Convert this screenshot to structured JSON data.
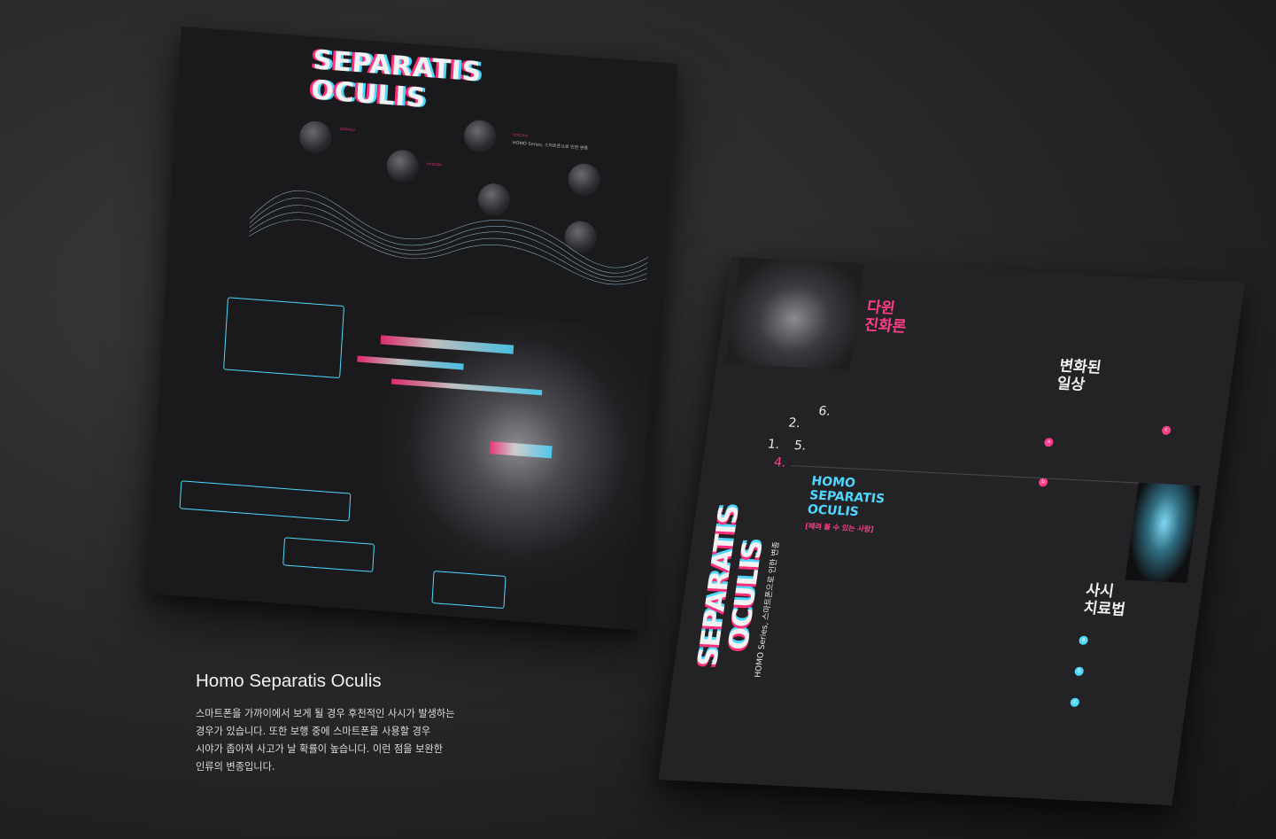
{
  "caption": {
    "title": "Homo Separatis Oculis",
    "lines": [
      "스마트폰을 가까이에서 보게 될 경우 후천적인 사시가 발생하는",
      "경우가 있습니다. 또한 보행 중에 스마트폰을 사용할 경우",
      "시야가 좁아져 사고가 날 확률이 높습니다. 이런 점을 보완한",
      "인류의 변종입니다."
    ]
  },
  "poster_left": {
    "title_line1": "SEPARATIS",
    "title_line2": "OCULIS",
    "series_label": "HOMO Series, 스마트폰으로 인한 변종"
  },
  "poster_right": {
    "section_darwin": "다윈\n진화론",
    "section_daily": "변화된\n일상",
    "section_therapy": "사시\n치료법",
    "title_line1": "SEPARATIS",
    "title_line2": "OCULIS",
    "series_label": "HOMO Series, 스마트폰으로 인한 변종",
    "cyan_title_1": "HOMO",
    "cyan_title_2": "SEPARATIS",
    "cyan_title_3": "OCULIS",
    "pink_subtitle": "[떼려 볼 수 있는 사람]",
    "steps": [
      "1.",
      "2.",
      "4.",
      "5.",
      "6."
    ],
    "badges": [
      "a",
      "b",
      "c"
    ]
  },
  "colors": {
    "accent_pink": "#ff3d8a",
    "accent_cyan": "#4fd8ff",
    "background": "#2b2b2d"
  }
}
